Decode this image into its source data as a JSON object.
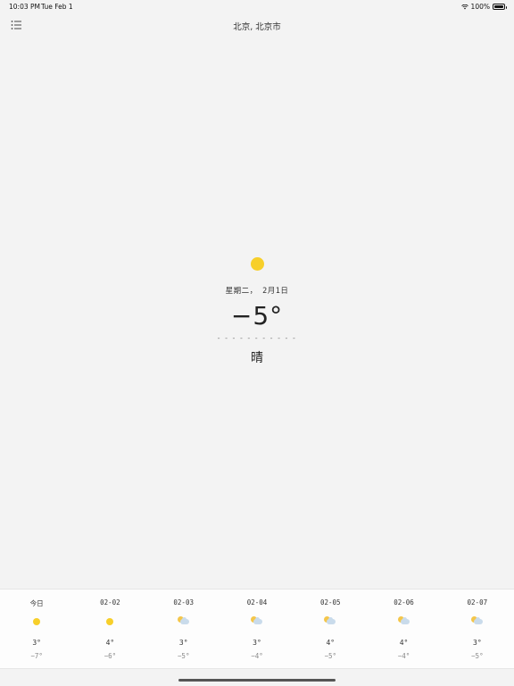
{
  "status_bar": {
    "time": "10:03 PM",
    "date": "Tue Feb 1",
    "battery": "100%"
  },
  "nav": {
    "title": "北京, 北京市"
  },
  "current": {
    "icon": "sun-icon",
    "date": "星期二， 2月1日",
    "temperature": "−5°",
    "divider": "- - - - - - - - - - -",
    "condition": "晴"
  },
  "forecast": [
    {
      "label": "今日",
      "icon": "sun-icon",
      "high": "3°",
      "low": "−7°"
    },
    {
      "label": "02-02",
      "icon": "sun-icon",
      "high": "4°",
      "low": "−6°"
    },
    {
      "label": "02-03",
      "icon": "partly-cloudy-icon",
      "high": "3°",
      "low": "−5°"
    },
    {
      "label": "02-04",
      "icon": "partly-cloudy-icon",
      "high": "3°",
      "low": "−4°"
    },
    {
      "label": "02-05",
      "icon": "partly-cloudy-icon",
      "high": "4°",
      "low": "−5°"
    },
    {
      "label": "02-06",
      "icon": "partly-cloudy-icon",
      "high": "4°",
      "low": "−4°"
    },
    {
      "label": "02-07",
      "icon": "partly-cloudy-icon",
      "high": "3°",
      "low": "−5°"
    }
  ],
  "colors": {
    "background": "#f3f3f3",
    "sun": "#f7cf2a",
    "cloud": "#c9dbeb"
  }
}
